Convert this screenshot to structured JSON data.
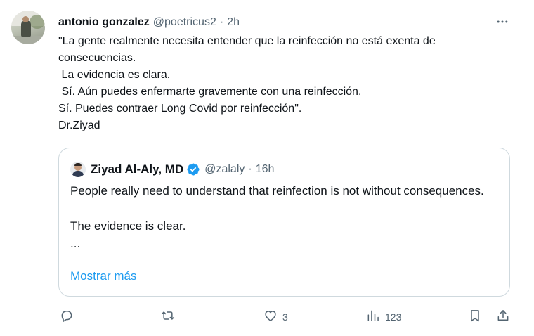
{
  "tweet": {
    "author_name": "antonio gonzalez",
    "author_handle": "@poetricus2",
    "separator": "·",
    "time": "2h",
    "more_icon": "more-horizontal-icon",
    "text": "\"La gente realmente necesita entender que la reinfección no está exenta de consecuencias.\n La evidencia es clara.\n Sí. Aún puedes enfermarte gravemente con una reinfección.\nSí. Puedes contraer Long Covid por reinfección\".\nDr.Ziyad"
  },
  "quote": {
    "author_name": "Ziyad Al-Aly, MD",
    "author_handle": "@zalaly",
    "separator": "·",
    "time": "16h",
    "verified_icon": "verified-badge-icon",
    "text": "People really need to understand that reinfection is not without consequences.\n\nThe evidence is clear.\n...",
    "show_more": "Mostrar más"
  },
  "actions": {
    "reply": {
      "icon": "reply-icon",
      "count": ""
    },
    "retweet": {
      "icon": "retweet-icon",
      "count": ""
    },
    "like": {
      "icon": "heart-icon",
      "count": "3"
    },
    "views": {
      "icon": "views-chart-icon",
      "count": "123"
    },
    "bookmark": {
      "icon": "bookmark-icon"
    },
    "share": {
      "icon": "share-icon"
    }
  },
  "colors": {
    "text": "#0f1419",
    "secondary": "#536471",
    "link": "#1d9bf0",
    "border": "#cfd9de",
    "verified": "#1d9bf0"
  }
}
